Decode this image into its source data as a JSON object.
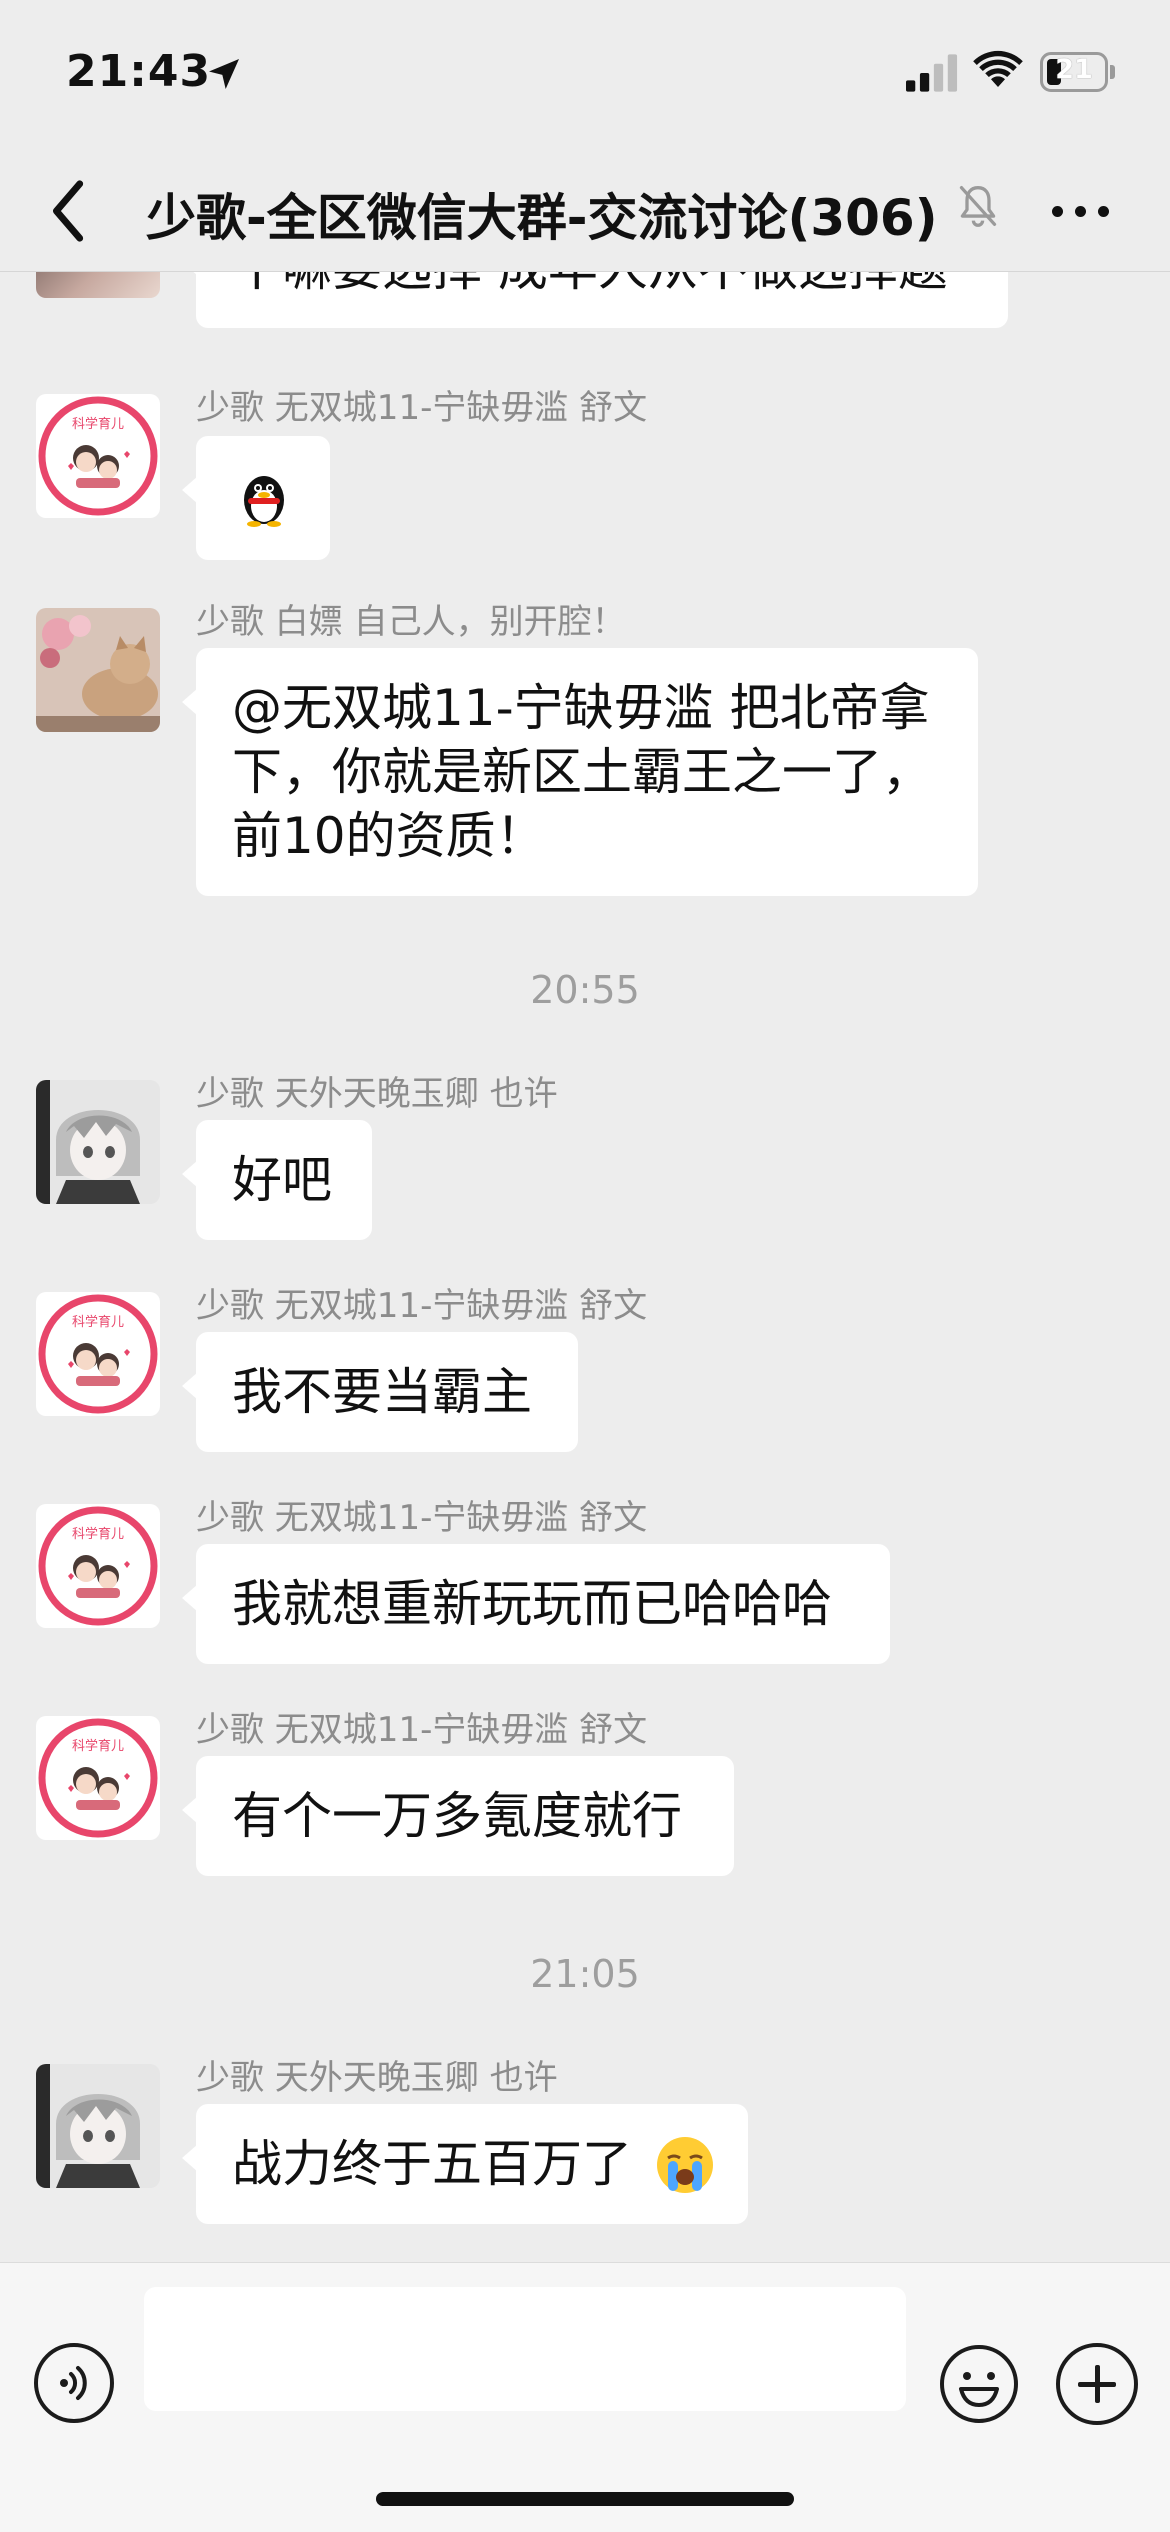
{
  "status_bar": {
    "time": "21:43",
    "battery_level": "21",
    "icons": [
      "location-arrow-icon",
      "cellular-signal-icon",
      "wifi-icon",
      "battery-icon"
    ]
  },
  "nav": {
    "title": "少歌-全区微信大群-交流讨论(306)",
    "icons": [
      "back-chevron-icon",
      "mute-bell-icon",
      "more-dots-icon"
    ]
  },
  "messages": [
    {
      "sender": "",
      "text": "干嘛要选择 成年人从不做选择题",
      "avatar": "baby-illustration"
    },
    {
      "sender": "少歌 无双城11-宁缺毋滥 舒文",
      "text": "",
      "sticker": "qq-penguin-icon",
      "avatar": "science-parenting-avatar"
    },
    {
      "sender": "少歌 白嫖 自己人，别开腔！",
      "lines": [
        "@无双城11-宁缺毋滥 把北帝拿",
        "下，你就是新区土霸王之一了，",
        "前10的资质！"
      ],
      "avatar": "cat-with-flowers"
    },
    {
      "sender": "少歌 天外天晚玉卿 也许",
      "text": "好吧",
      "avatar": "anime-boy-avatar"
    },
    {
      "sender": "少歌 无双城11-宁缺毋滥 舒文",
      "text": "我不要当霸主",
      "avatar": "science-parenting-avatar"
    },
    {
      "sender": "少歌 无双城11-宁缺毋滥 舒文",
      "text": "我就想重新玩玩而已哈哈哈",
      "avatar": "science-parenting-avatar"
    },
    {
      "sender": "少歌 无双城11-宁缺毋滥 舒文",
      "text": "有个一万多氪度就行",
      "avatar": "science-parenting-avatar"
    },
    {
      "sender": "少歌 天外天晚玉卿 也许",
      "text": "战力终于五百万了",
      "emoji": "loudly-crying-face-icon",
      "avatar": "anime-boy-avatar"
    }
  ],
  "time_separators": [
    "20:55",
    "21:05"
  ],
  "avatar_badge_text": "科学育儿",
  "input": {
    "value": "",
    "placeholder": ""
  },
  "bottom_bar": {
    "icons": [
      "voice-icon",
      "emoji-icon",
      "plus-icon"
    ]
  },
  "colors": {
    "background": "#ededed",
    "bubble": "#ffffff",
    "sender_text": "#8c8c8c",
    "avatar_ring": "#e8466b"
  }
}
